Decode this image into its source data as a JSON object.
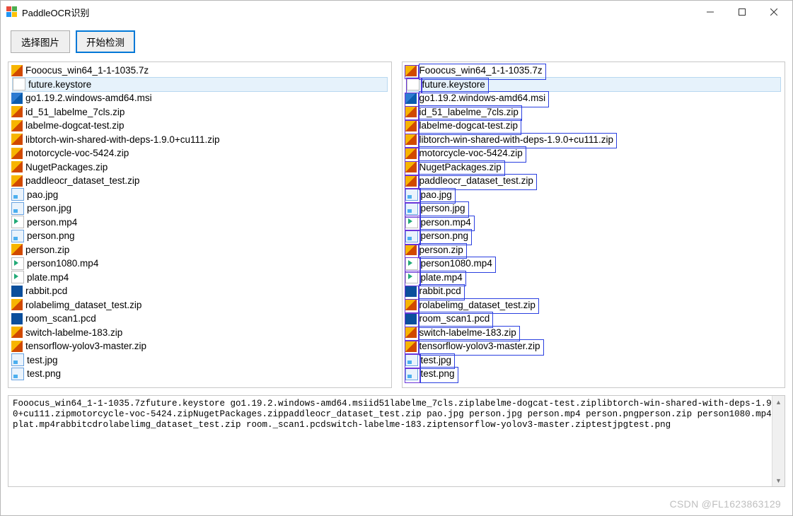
{
  "window": {
    "title": "PaddleOCR识别"
  },
  "toolbar": {
    "select_image_label": "选择图片",
    "start_detect_label": "开始检测"
  },
  "files": [
    {
      "name": "Fooocus_win64_1-1-1035.7z",
      "icon": "7z",
      "selected": false
    },
    {
      "name": "future.keystore",
      "icon": "blank",
      "selected": true
    },
    {
      "name": "go1.19.2.windows-amd64.msi",
      "icon": "msi",
      "selected": false
    },
    {
      "name": "id_51_labelme_7cls.zip",
      "icon": "zip",
      "selected": false
    },
    {
      "name": "labelme-dogcat-test.zip",
      "icon": "zip",
      "selected": false
    },
    {
      "name": "libtorch-win-shared-with-deps-1.9.0+cu111.zip",
      "icon": "zip",
      "selected": false
    },
    {
      "name": "motorcycle-voc-5424.zip",
      "icon": "zip",
      "selected": false
    },
    {
      "name": "NugetPackages.zip",
      "icon": "zip",
      "selected": false
    },
    {
      "name": "paddleocr_dataset_test.zip",
      "icon": "zip",
      "selected": false
    },
    {
      "name": "pao.jpg",
      "icon": "img",
      "selected": false
    },
    {
      "name": "person.jpg",
      "icon": "img",
      "selected": false
    },
    {
      "name": "person.mp4",
      "icon": "mp4",
      "selected": false
    },
    {
      "name": "person.png",
      "icon": "img",
      "selected": false
    },
    {
      "name": "person.zip",
      "icon": "zip",
      "selected": false
    },
    {
      "name": "person1080.mp4",
      "icon": "mp4",
      "selected": false
    },
    {
      "name": "plate.mp4",
      "icon": "mp4",
      "selected": false
    },
    {
      "name": "rabbit.pcd",
      "icon": "pcd",
      "selected": false
    },
    {
      "name": "rolabelimg_dataset_test.zip",
      "icon": "zip",
      "selected": false
    },
    {
      "name": "room_scan1.pcd",
      "icon": "pcd",
      "selected": false
    },
    {
      "name": "switch-labelme-183.zip",
      "icon": "zip",
      "selected": false
    },
    {
      "name": "tensorflow-yolov3-master.zip",
      "icon": "zip",
      "selected": false
    },
    {
      "name": "test.jpg",
      "icon": "img",
      "selected": false
    },
    {
      "name": "test.png",
      "icon": "img",
      "selected": false
    }
  ],
  "ocr_output": "Fooocus_win64_1-1-1035.7zfuture.keystore go1.19.2.windows-amd64.msiid51labelme_7cls.ziplabelme-dogcat-test.ziplibtorch-win-shared-with-deps-1.9.0+cu111.zipmotorcycle-voc-5424.zipNugetPackages.zippaddleocr_dataset_test.zip pao.jpg person.jpg person.mp4 person.pngperson.zip person1080.mp4 plat.mp4rabbitcdrolabelimg_dataset_test.zip room._scan1.pcdswitch-labelme-183.ziptensorflow-yolov3-master.ziptestjpgtest.png",
  "watermark": "CSDN @FL1623863129"
}
